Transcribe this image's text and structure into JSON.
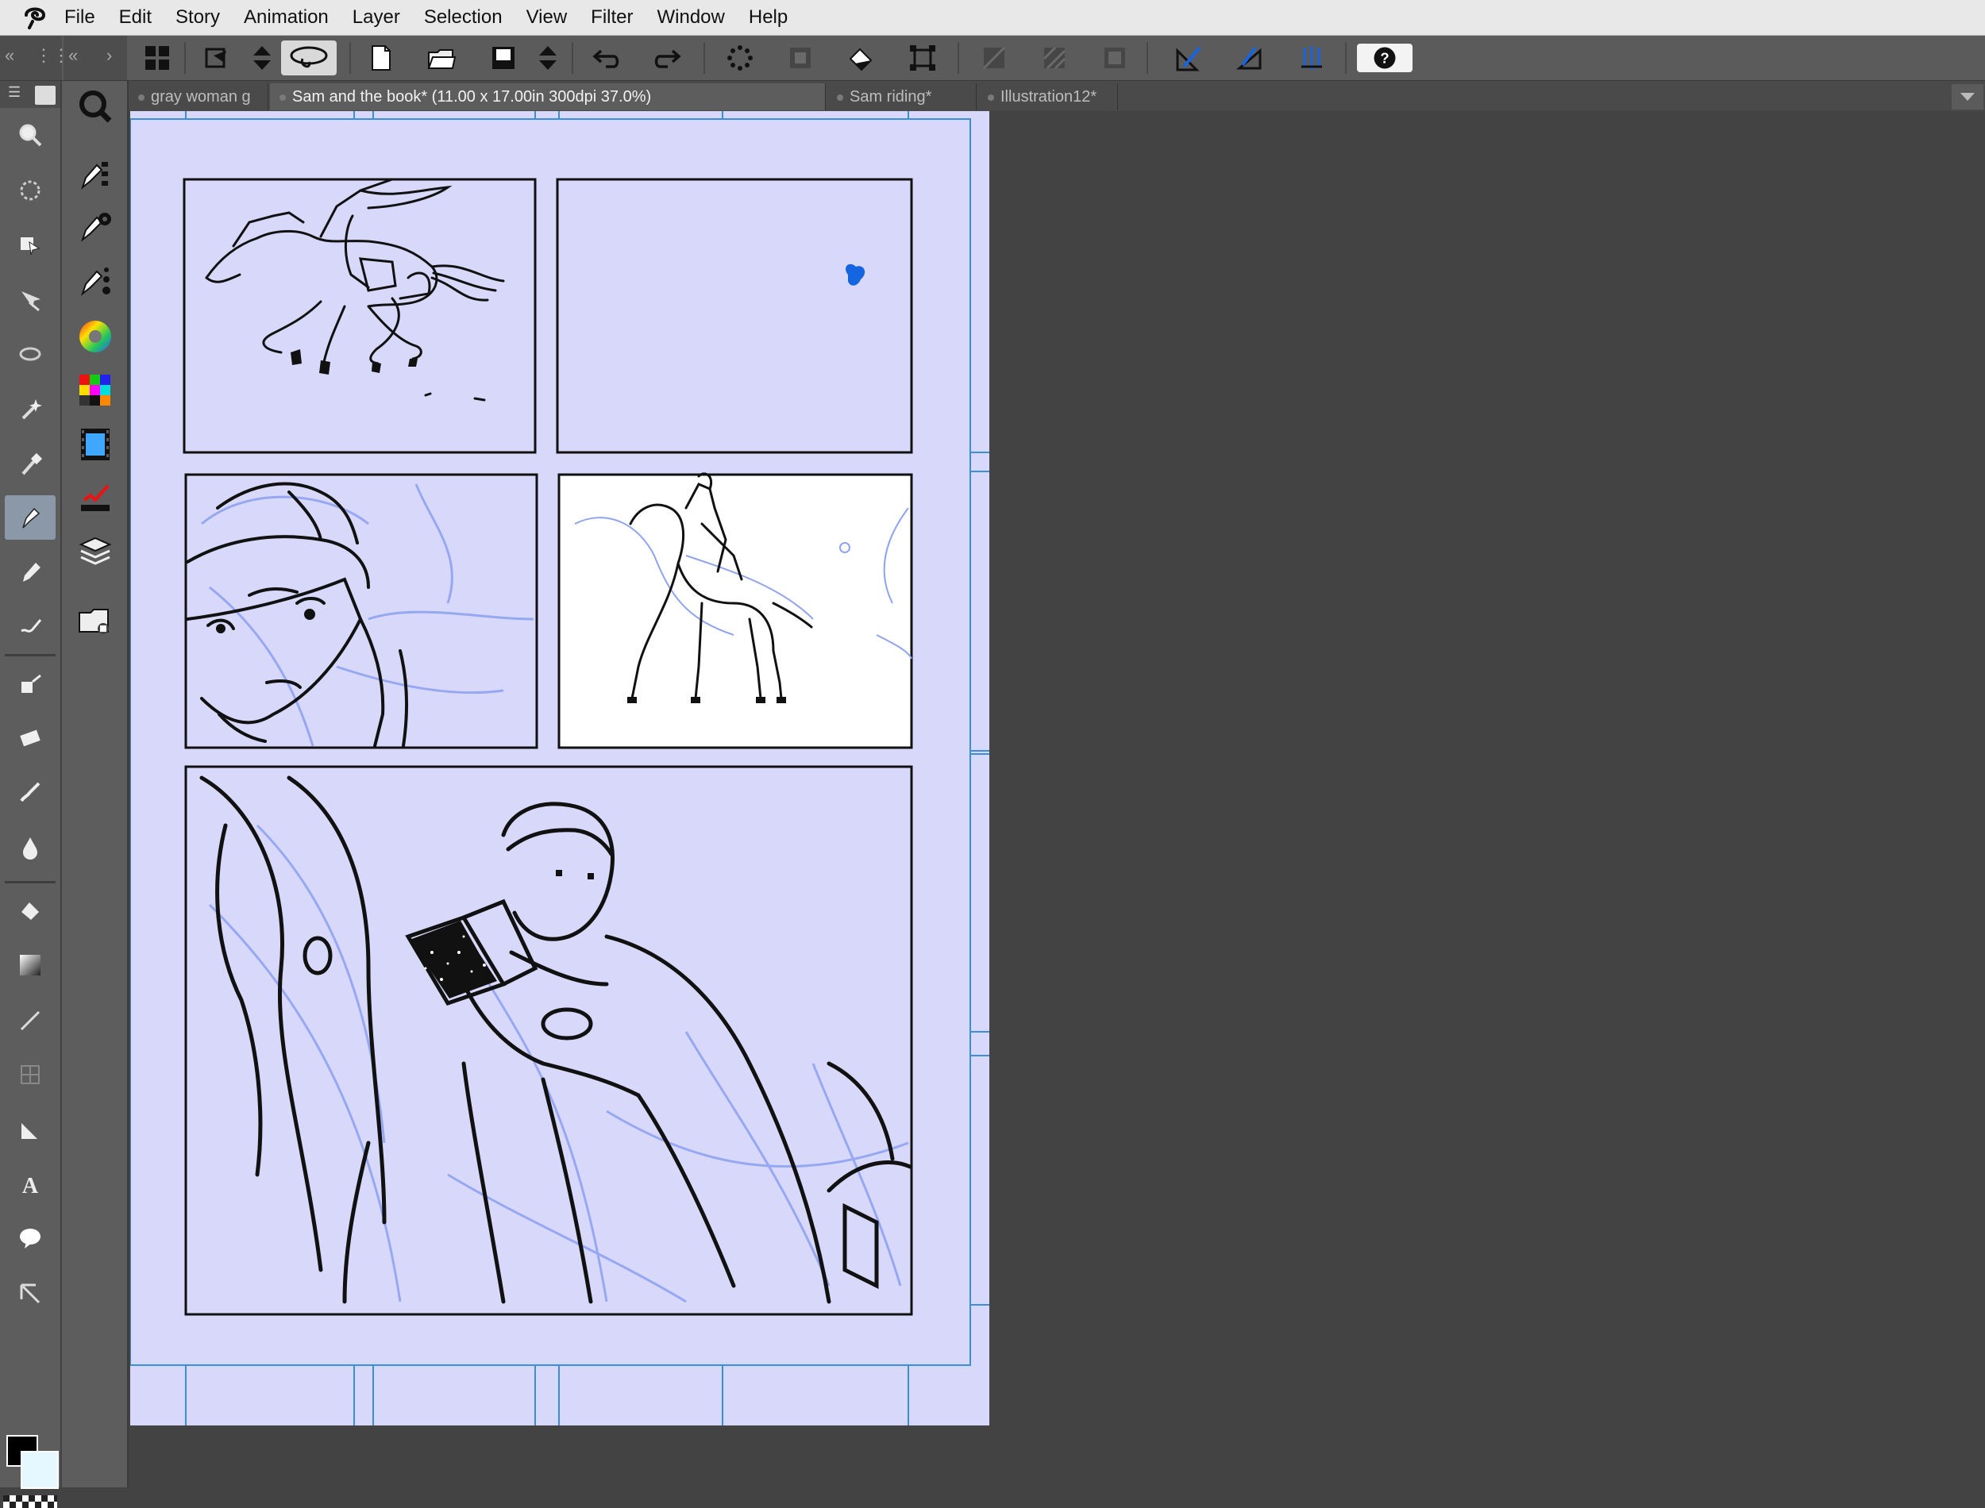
{
  "menu": {
    "items": [
      "File",
      "Edit",
      "Story",
      "Animation",
      "Layer",
      "Selection",
      "View",
      "Filter",
      "Window",
      "Help"
    ]
  },
  "tabs": [
    {
      "label": "gray woman g",
      "active": false
    },
    {
      "label": "Sam and the book* (11.00 x 17.00in 300dpi 37.0%)",
      "active": true
    },
    {
      "label": "Sam riding*",
      "active": false
    },
    {
      "label": "Illustration12*",
      "active": false
    }
  ],
  "toolbar": {
    "icons": [
      "grid-view-icon",
      "transform-icon",
      "stepper-icon",
      "lasso-icon",
      "new-file-icon",
      "open-folder-icon",
      "save-icon",
      "stepper-icon",
      "undo-icon",
      "redo-icon",
      "select-all-icon",
      "invert-selection-icon",
      "fill-icon",
      "transform-selection-icon",
      "clear-icon",
      "tone-icon",
      "deselect-icon",
      "ruler-snap-icon",
      "perspective-ruler-icon",
      "snap-special-icon",
      "help-icon"
    ]
  },
  "tools": [
    "zoom-icon",
    "rotate-icon",
    "move-icon",
    "operation-icon",
    "lasso-select-icon",
    "magic-wand-icon",
    "eyedropper-icon",
    "pen-icon",
    "pencil-icon",
    "brush-icon",
    "airbrush-icon",
    "eraser-icon",
    "blend-icon",
    "fill-icon",
    "gradient-icon",
    "line-icon",
    "frame-icon",
    "ruler-icon",
    "text-icon",
    "balloon-icon",
    "correct-line-icon"
  ],
  "colors": {
    "accent": "#1565e0",
    "page": "#d8d8fb",
    "guide": "#3a8fd6",
    "main_color": "#000000",
    "sub_color": "#e6f8ff"
  }
}
